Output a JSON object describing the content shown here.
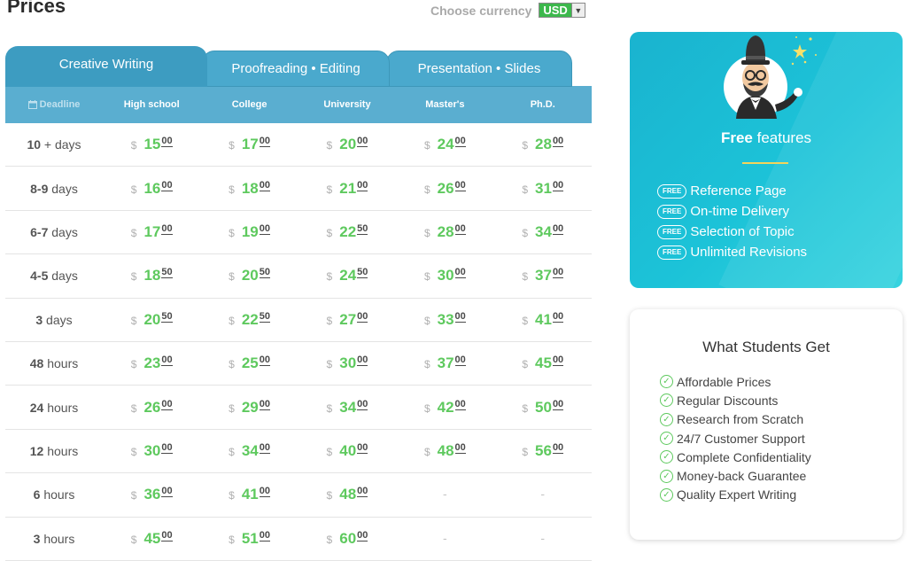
{
  "page": {
    "title": "Prices"
  },
  "currency": {
    "label": "Choose currency",
    "value": "USD"
  },
  "tabs": [
    {
      "label": "Creative Writing"
    },
    {
      "label": "Proofreading • Editing"
    },
    {
      "label": "Presentation • Slides"
    }
  ],
  "table": {
    "headers": [
      "Deadline",
      "High school",
      "College",
      "University",
      "Master's",
      "Ph.D."
    ],
    "currency_symbol": "$",
    "rows": [
      {
        "deadline_num": "10",
        "deadline_unit": " + days",
        "prices": [
          [
            "15",
            "00"
          ],
          [
            "17",
            "00"
          ],
          [
            "20",
            "00"
          ],
          [
            "24",
            "00"
          ],
          [
            "28",
            "00"
          ]
        ]
      },
      {
        "deadline_num": "8-9",
        "deadline_unit": " days",
        "prices": [
          [
            "16",
            "00"
          ],
          [
            "18",
            "00"
          ],
          [
            "21",
            "00"
          ],
          [
            "26",
            "00"
          ],
          [
            "31",
            "00"
          ]
        ]
      },
      {
        "deadline_num": "6-7",
        "deadline_unit": " days",
        "prices": [
          [
            "17",
            "00"
          ],
          [
            "19",
            "00"
          ],
          [
            "22",
            "50"
          ],
          [
            "28",
            "00"
          ],
          [
            "34",
            "00"
          ]
        ]
      },
      {
        "deadline_num": "4-5",
        "deadline_unit": " days",
        "prices": [
          [
            "18",
            "50"
          ],
          [
            "20",
            "50"
          ],
          [
            "24",
            "50"
          ],
          [
            "30",
            "00"
          ],
          [
            "37",
            "00"
          ]
        ]
      },
      {
        "deadline_num": "3",
        "deadline_unit": " days",
        "prices": [
          [
            "20",
            "50"
          ],
          [
            "22",
            "50"
          ],
          [
            "27",
            "00"
          ],
          [
            "33",
            "00"
          ],
          [
            "41",
            "00"
          ]
        ]
      },
      {
        "deadline_num": "48",
        "deadline_unit": " hours",
        "prices": [
          [
            "23",
            "00"
          ],
          [
            "25",
            "00"
          ],
          [
            "30",
            "00"
          ],
          [
            "37",
            "00"
          ],
          [
            "45",
            "00"
          ]
        ]
      },
      {
        "deadline_num": "24",
        "deadline_unit": " hours",
        "prices": [
          [
            "26",
            "00"
          ],
          [
            "29",
            "00"
          ],
          [
            "34",
            "00"
          ],
          [
            "42",
            "00"
          ],
          [
            "50",
            "00"
          ]
        ]
      },
      {
        "deadline_num": "12",
        "deadline_unit": " hours",
        "prices": [
          [
            "30",
            "00"
          ],
          [
            "34",
            "00"
          ],
          [
            "40",
            "00"
          ],
          [
            "48",
            "00"
          ],
          [
            "56",
            "00"
          ]
        ]
      },
      {
        "deadline_num": "6",
        "deadline_unit": " hours",
        "prices": [
          [
            "36",
            "00"
          ],
          [
            "41",
            "00"
          ],
          [
            "48",
            "00"
          ],
          null,
          null
        ]
      },
      {
        "deadline_num": "3",
        "deadline_unit": " hours",
        "prices": [
          [
            "45",
            "00"
          ],
          [
            "51",
            "00"
          ],
          [
            "60",
            "00"
          ],
          null,
          null
        ]
      }
    ],
    "empty_mark": "-"
  },
  "free_features": {
    "title_bold": "Free",
    "title_rest": " features",
    "badge": "FREE",
    "items": [
      "Reference Page",
      "On-time Delivery",
      "Selection of Topic",
      "Unlimited Revisions"
    ]
  },
  "students": {
    "title": "What Students Get",
    "items": [
      "Affordable Prices",
      "Regular Discounts",
      "Research from Scratch",
      "24/7 Customer Support",
      "Complete Confidentiality",
      "Money-back Guarantee",
      "Quality Expert Writing"
    ]
  },
  "colors": {
    "accent": "#3d9cc1",
    "header": "#5aaed0",
    "price": "#5ec95e",
    "card": "#1cc3d8",
    "currency_bg": "#3cb84c"
  },
  "icons": {
    "deadline": "calendar-icon",
    "dropdown": "chevron-down-icon",
    "check": "check-circle-icon"
  }
}
